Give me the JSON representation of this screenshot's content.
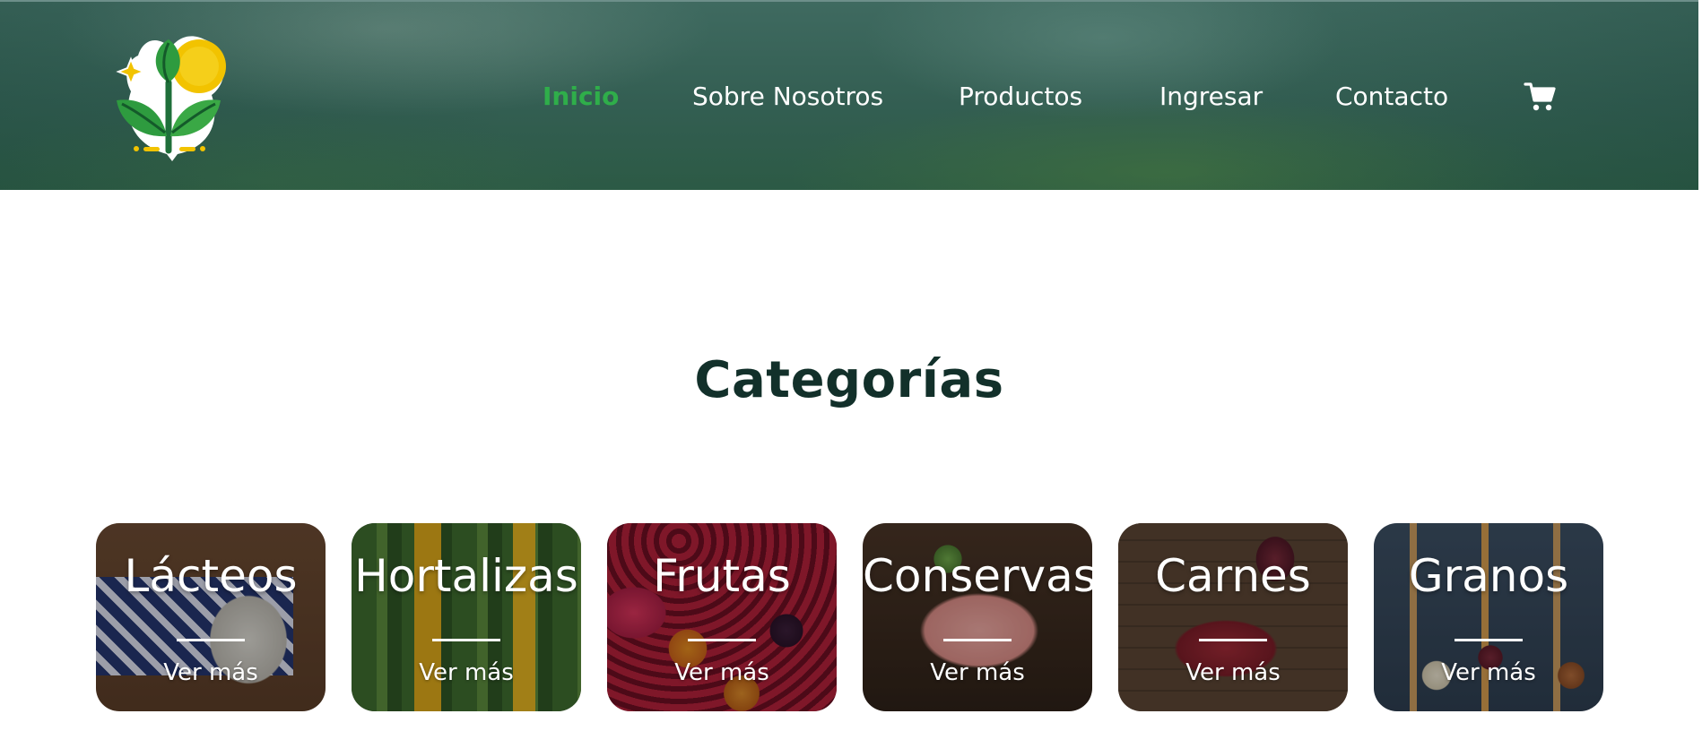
{
  "header": {
    "logo_alt": "Logo",
    "nav": [
      {
        "label": "Inicio",
        "active": true
      },
      {
        "label": "Sobre Nosotros",
        "active": false
      },
      {
        "label": "Productos",
        "active": false
      },
      {
        "label": "Ingresar",
        "active": false
      },
      {
        "label": "Contacto",
        "active": false
      }
    ],
    "cart_icon": "cart-icon"
  },
  "main": {
    "section_title": "Categorías",
    "categories": [
      {
        "title": "Lácteos",
        "more": "Ver más"
      },
      {
        "title": "Hortalizas",
        "more": "Ver más"
      },
      {
        "title": "Frutas",
        "more": "Ver más"
      },
      {
        "title": "Conservas",
        "more": "Ver más"
      },
      {
        "title": "Carnes",
        "more": "Ver más"
      },
      {
        "title": "Granos",
        "more": "Ver más"
      }
    ]
  },
  "colors": {
    "header_bg": "#335e52",
    "nav_active": "#2fae4a",
    "title_text": "#12302a"
  }
}
